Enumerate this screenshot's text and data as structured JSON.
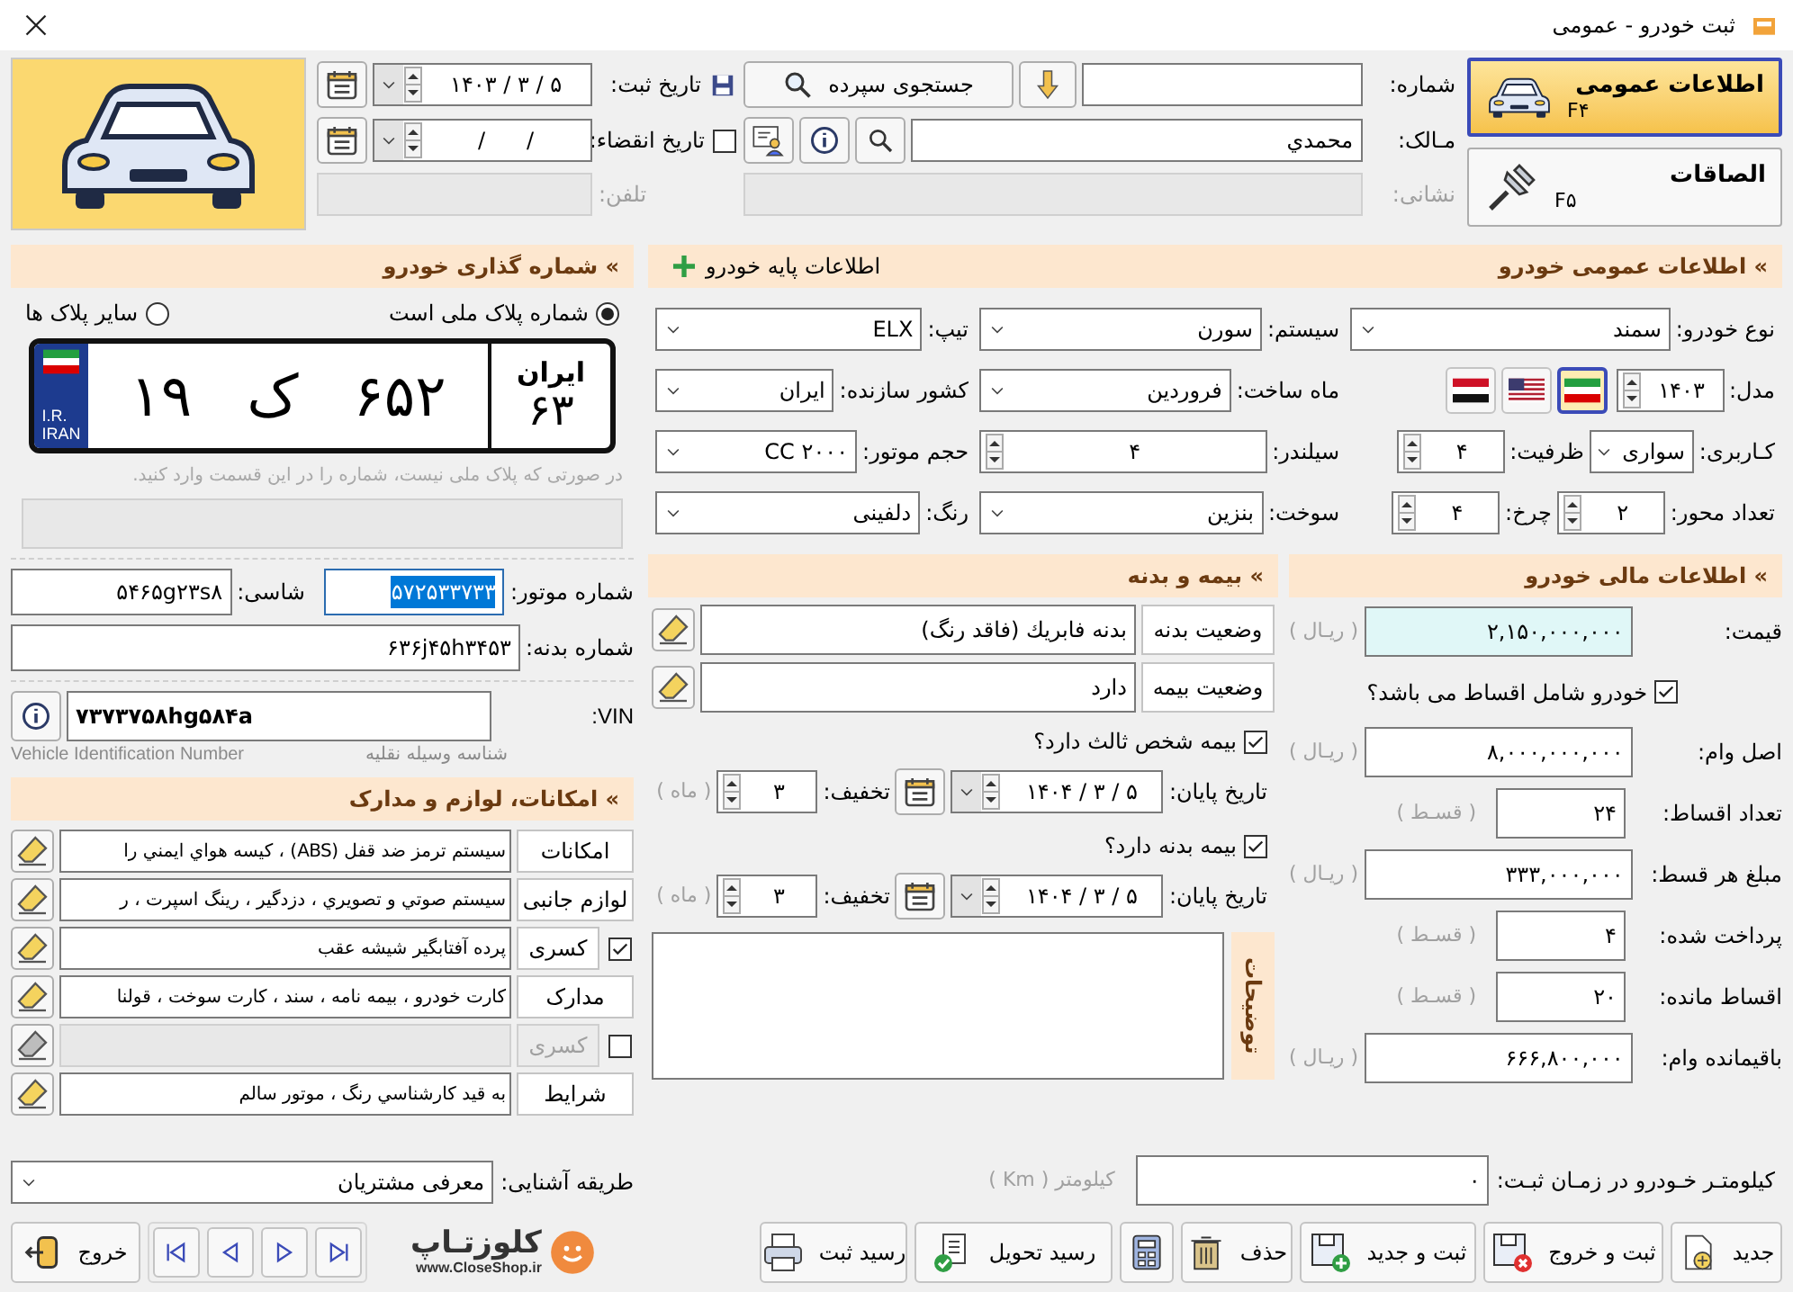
{
  "window": {
    "title": "ثبت خودرو - عمومی"
  },
  "nav": [
    {
      "kind": "car",
      "label": "اطلاعات عمومی",
      "shortcut": "F۴",
      "selected": true
    },
    {
      "kind": "pin",
      "label": "الصاقات",
      "shortcut": "F۵",
      "selected": false
    }
  ],
  "header": {
    "number": {
      "label": "شماره:"
    },
    "search_button": "جستجوی سپرده",
    "owner": {
      "label": "مـالک:",
      "value": "محمدي"
    },
    "address": {
      "label": "نشانی:",
      "disabled": true
    },
    "registration_date": {
      "label": "تاریخ ثبت:",
      "value": "۱۴۰۳ / ۳ / ۵"
    },
    "expiry_date": {
      "label": "تاریخ انقضاء:",
      "checked": false,
      "value": "/      /"
    },
    "phone": {
      "label": "تلفن:",
      "disabled": true
    }
  },
  "general": {
    "title": "» اطلاعات عمومی خودرو",
    "base_button": "اطلاعات پایه خودرو",
    "rows": [
      [
        [
          {
            "kind": "combo",
            "label": "نوع خودرو:",
            "value": "سمند"
          }
        ],
        [
          {
            "kind": "combo",
            "label": "سیستم:",
            "value": "سورن"
          }
        ],
        [
          {
            "kind": "combo",
            "label": "تیپ:",
            "value": "ELX"
          }
        ]
      ],
      [
        [
          {
            "kind": "spin",
            "label": "مدل:",
            "value": "۱۴۰۳"
          },
          {
            "kind": "flags",
            "flags": [
              {
                "kind": "iran",
                "selected": true
              },
              {
                "kind": "usa",
                "selected": false
              },
              {
                "kind": "iraq",
                "selected": false
              }
            ]
          }
        ],
        [
          {
            "kind": "combo",
            "label": "ماه ساخت:",
            "value": "فروردین"
          }
        ],
        [
          {
            "kind": "combo",
            "label": "کشور سازنده:",
            "value": "ایران"
          }
        ]
      ],
      [
        [
          {
            "kind": "combo",
            "label": "کـاربری:",
            "value": "سواری"
          },
          {
            "kind": "spin",
            "label": "ظرفیت:",
            "value": "۴"
          }
        ],
        [
          {
            "kind": "spin",
            "label": "سیلندر:",
            "value": "۴"
          }
        ],
        [
          {
            "kind": "combo",
            "label": "حجم موتور:",
            "value": "۲۰۰۰ CC"
          }
        ]
      ],
      [
        [
          {
            "kind": "spin",
            "label": "تعداد محور:",
            "value": "۲"
          },
          {
            "kind": "spin",
            "label": "چرخ:",
            "value": "۴"
          }
        ],
        [
          {
            "kind": "combo",
            "label": "سوخت:",
            "value": "بنزین"
          }
        ],
        [
          {
            "kind": "combo",
            "label": "رنگ:",
            "value": "دلفینی"
          }
        ]
      ]
    ]
  },
  "finance": {
    "title": "» اطلاعات مالی خودرو",
    "rows": [
      {
        "kind": "amount",
        "label": "قیمت:",
        "value": "۲,۱۵۰,۰۰۰,۰۰۰",
        "unit": "( ریـال )",
        "highlighted": true
      },
      {
        "kind": "checkbox",
        "label": "خودرو شامل اقساط می باشد؟",
        "checked": true
      },
      {
        "kind": "amount",
        "label": "اصل وام:",
        "value": "۸,۰۰۰,۰۰۰,۰۰۰",
        "unit": "( ریـال )",
        "highlighted": false
      },
      {
        "kind": "count",
        "label": "تعداد اقساط:",
        "value": "۲۴",
        "unit": "( قسـط )"
      },
      {
        "kind": "amount",
        "label": "مبلغ هر قسط:",
        "value": "۳۳۳,۰۰۰,۰۰۰",
        "unit": "( ریـال )",
        "highlighted": false
      },
      {
        "kind": "count",
        "label": "پرداخت شده:",
        "value": "۴",
        "unit": "( قسـط )"
      },
      {
        "kind": "count",
        "label": "اقساط مانده:",
        "value": "۲۰",
        "unit": "( قسـط )"
      },
      {
        "kind": "amount",
        "label": "باقیمانده وام:",
        "value": "۶۶۶,۸۰۰,۰۰۰",
        "unit": "( ریـال )",
        "highlighted": false
      }
    ]
  },
  "insurance": {
    "title": "» بیمه و بدنه",
    "status": [
      {
        "label": "وضعیت بدنه",
        "value": "بدنه فابریك (فاقد رنگ)"
      },
      {
        "label": "وضعیت بیمه",
        "value": "دارد"
      }
    ],
    "policies": [
      {
        "label": "بیمه شخص ثالث دارد؟",
        "checked": true,
        "end_label": "تاریخ پایان:",
        "end_date": "۱۴۰۴ / ۳ / ۵",
        "discount_label": "تخفیف:",
        "discount": "۳",
        "unit": "( ماه )"
      },
      {
        "label": "بیمه بدنه دارد؟",
        "checked": true,
        "end_label": "تاریخ پایان:",
        "end_date": "۱۴۰۴ / ۳ / ۵",
        "discount_label": "تخفیف:",
        "discount": "۳",
        "unit": "( ماه )"
      }
    ],
    "notes_label": "توضیحات"
  },
  "plate_section": {
    "title": "» شماره گذاری خودرو",
    "options": [
      {
        "label": "شماره پلاک ملی است",
        "selected": true
      },
      {
        "label": "سایر پلاک ها",
        "selected": false
      }
    ],
    "plate": {
      "country_code": "I.R.",
      "country": "IRAN",
      "serial": "۱۹",
      "letter": "ک",
      "number": "۶۵۲",
      "region_label": "ایران",
      "region": "۶۳"
    },
    "hint": "در صورتی که پلاک ملی نیست، شماره را در این قسمت وارد کنید.",
    "engine": {
      "label": "شماره موتور:",
      "value": "۵۷۲۵۳۳۷۳۳",
      "text_selected": true
    },
    "chassis": {
      "label": "شاسی:",
      "value": "۵۴۶۵g۲۳s۸"
    },
    "body": {
      "label": "شماره بدنه:",
      "value": "۶۳۶j۴۵h۳۴۵۳"
    },
    "vin": {
      "label": "VIN:",
      "value": "۷۳۷۳۷۵۸hg۵۸۴a",
      "caption": "شناسه وسیله نقلیه",
      "caption_en": "Vehicle Identification Number"
    }
  },
  "extras": {
    "title": "» امکانات، لوازم و مدارک",
    "rows": [
      {
        "kind": "plain",
        "label": "امکانات",
        "value": "سیستم ترمز ضد قفل (ABS) ، کیسه هواي ایمني را"
      },
      {
        "kind": "plain",
        "label": "لوازم جانبی",
        "value": "سیستم صوتي و تصويري ، دزدگیر ، رینگ اسپرت ، ر"
      },
      {
        "kind": "checkable",
        "label": "کسری",
        "value": "پرده آفتابگیر شیشه عقب",
        "checked": true,
        "disabled": false
      },
      {
        "kind": "plain",
        "label": "مدارک",
        "value": "کارت خودرو ، بیمه نامه ، سند ، کارت سوخت ، قولنا"
      },
      {
        "kind": "checkable",
        "label": "کسری",
        "checked": false,
        "disabled": true
      },
      {
        "kind": "plain",
        "label": "شرایط",
        "value": "به قید کارشناسي رنگ ، موتور سالم"
      }
    ]
  },
  "acquaintance": {
    "label": "طریقه آشنایی:",
    "value": "معرفی مشتریان"
  },
  "km": {
    "label": "کیلومتـر خـودرو در زمـان ثبـت:",
    "value": "۰",
    "unit": "کیلومتر ( Km )"
  },
  "actions": [
    {
      "kind": "new",
      "label": "جدید"
    },
    {
      "kind": "save_exit",
      "label": "ثبت و خروج"
    },
    {
      "kind": "save_new",
      "label": "ثبت و جدید"
    },
    {
      "kind": "delete",
      "label": "حذف"
    },
    {
      "kind": "calculator"
    },
    {
      "kind": "delivery_receipt",
      "label": "رسید تحویل"
    },
    {
      "kind": "print_receipt",
      "label": "رسید ثبت"
    }
  ],
  "logo": {
    "name": "کلوزتـاپ",
    "url": "www.CloseShop.ir"
  },
  "exit_button": "خروج"
}
